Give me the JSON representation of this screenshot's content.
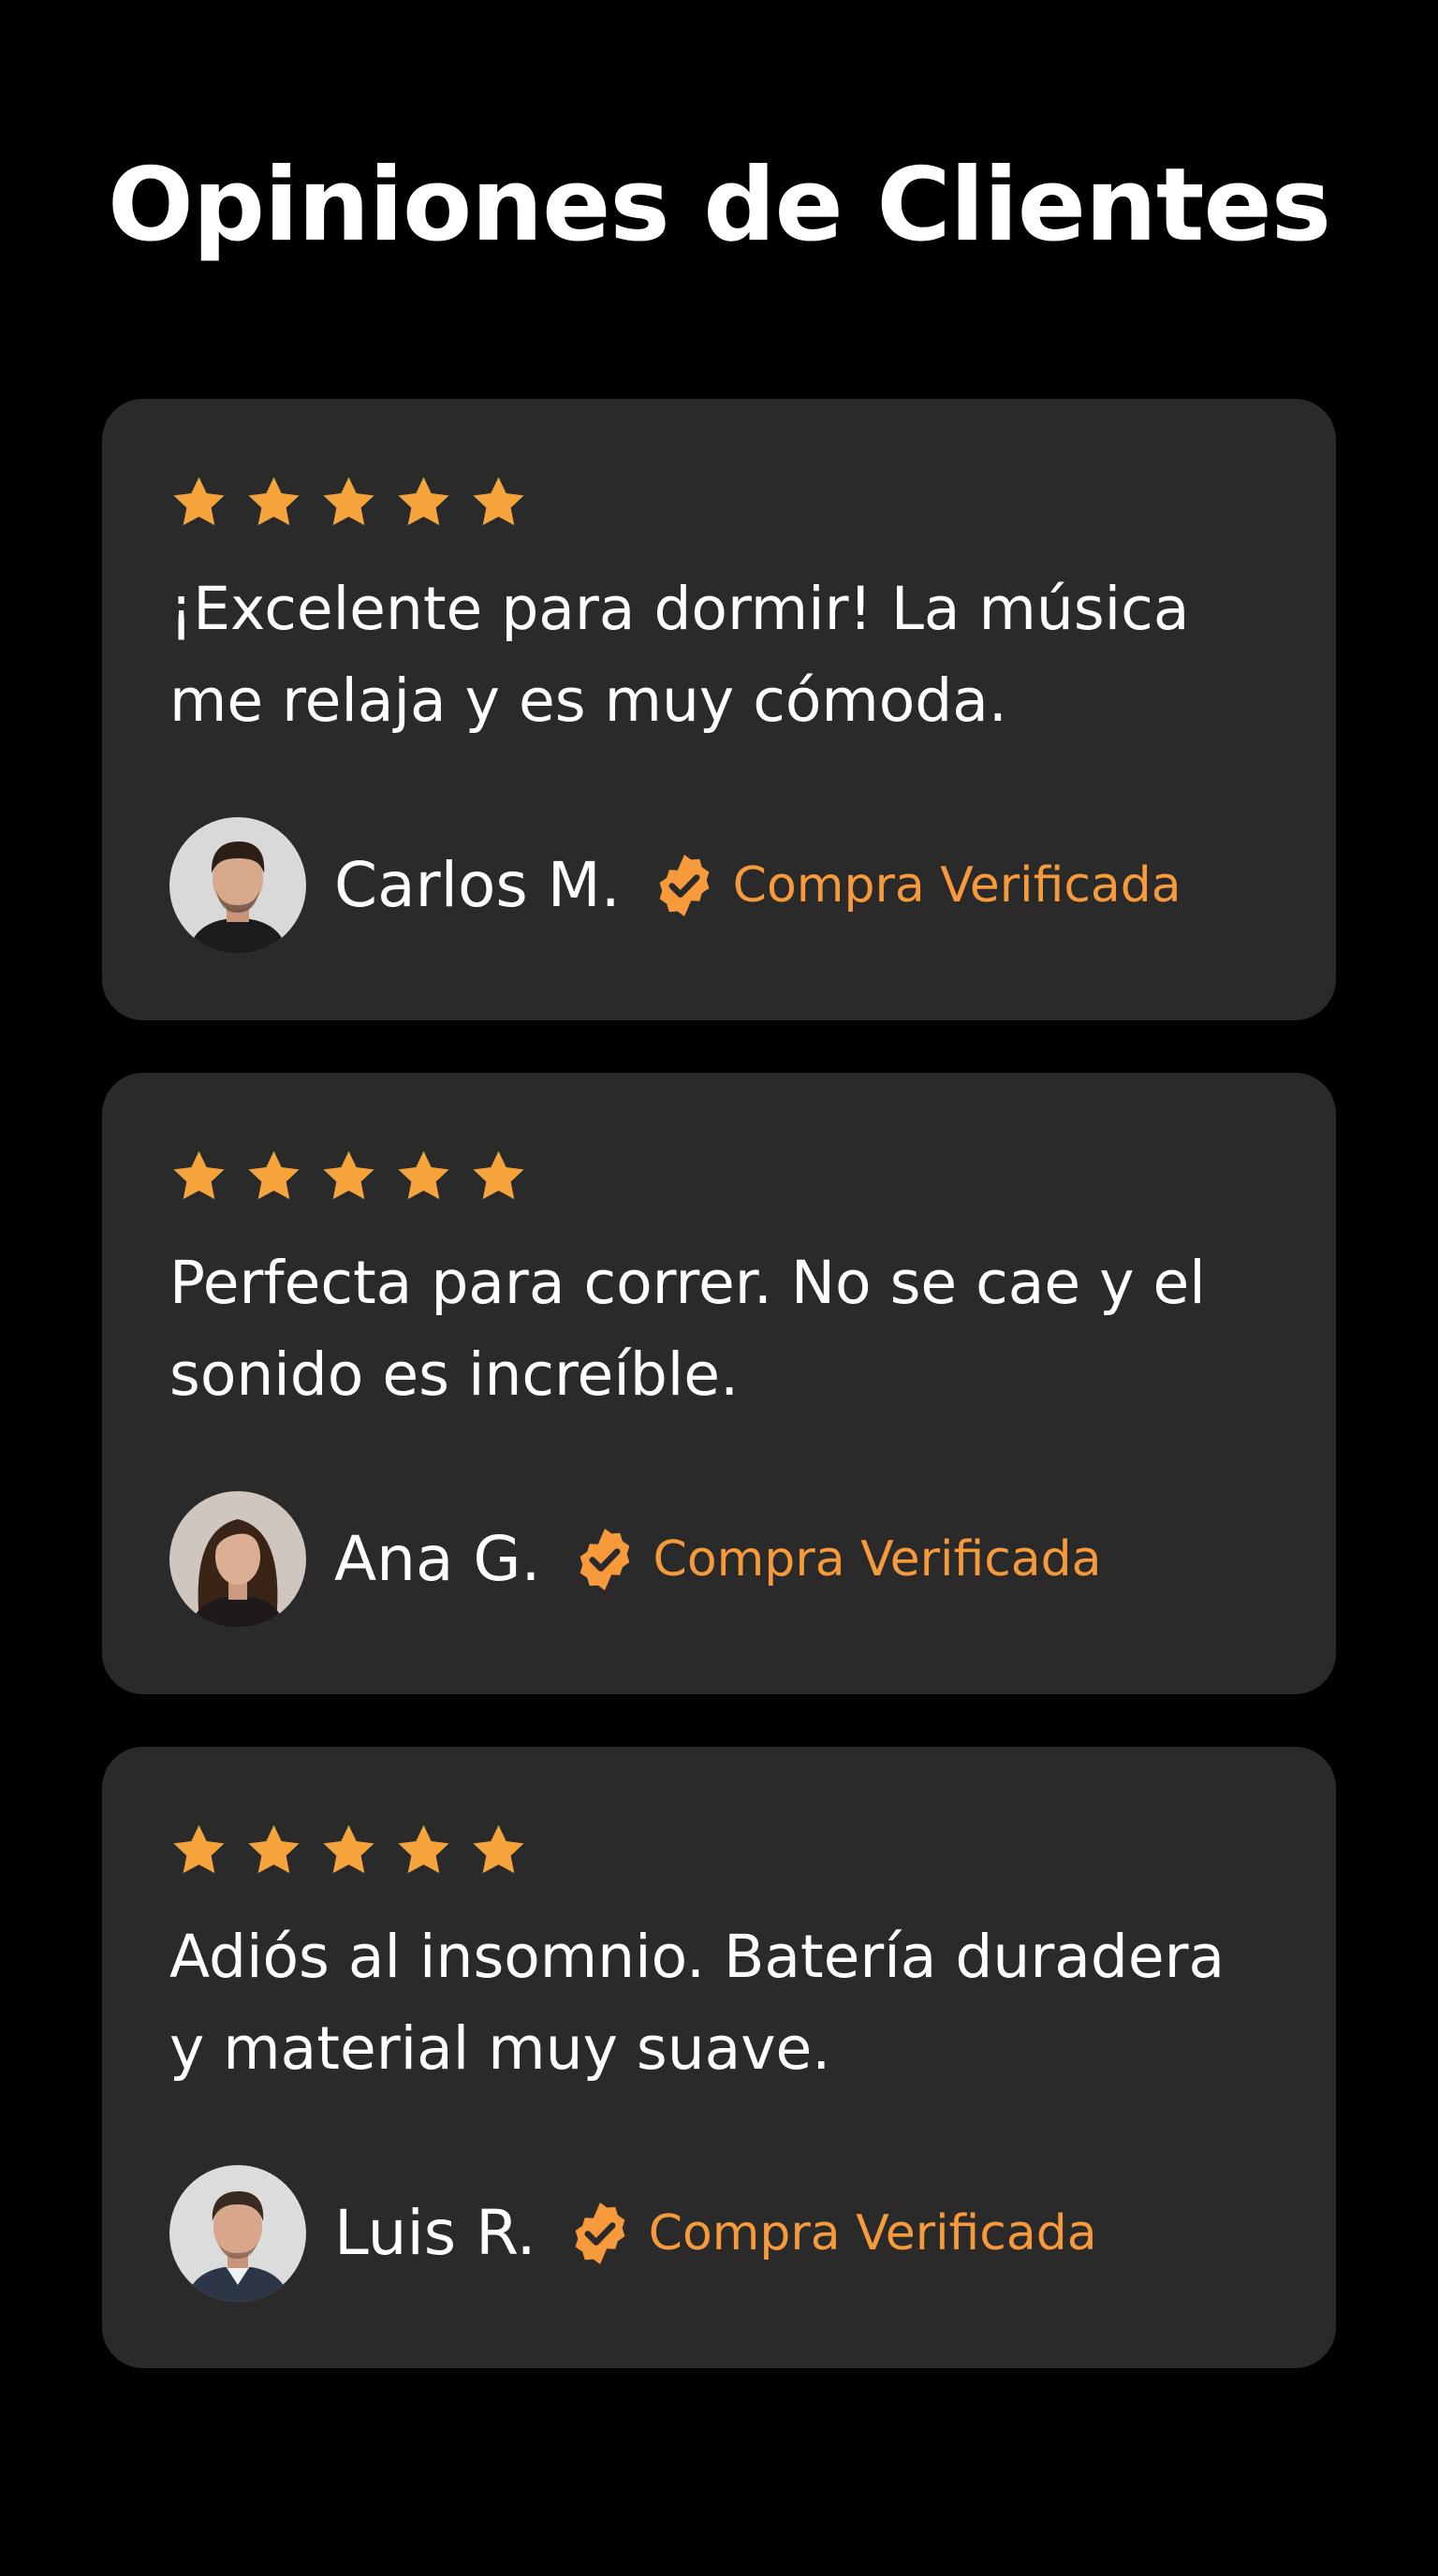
{
  "page": {
    "title": "Opiniones de Clientes"
  },
  "colors": {
    "background": "#000000",
    "card": "#2a2a2a",
    "star": "#f7a33b",
    "accent": "#f79a3b"
  },
  "reviews": [
    {
      "rating": 5,
      "text": "¡Excelente para dormir! La música me relaja y es muy cómoda.",
      "author": "Carlos M.",
      "badge_icon": "verified-check-icon",
      "badge_label": "Compra Verificada",
      "avatar": "avatar-man-dark-hair"
    },
    {
      "rating": 5,
      "text": "Perfecta para correr. No se cae y el sonido es increíble.",
      "author": "Ana G.",
      "badge_icon": "verified-check-icon",
      "badge_label": "Compra Verificada",
      "avatar": "avatar-woman-long-hair"
    },
    {
      "rating": 5,
      "text": "Adiós al insomnio. Batería duradera y material muy suave.",
      "author": "Luis R.",
      "badge_icon": "verified-check-icon",
      "badge_label": "Compra Verificada",
      "avatar": "avatar-man-suit"
    }
  ]
}
